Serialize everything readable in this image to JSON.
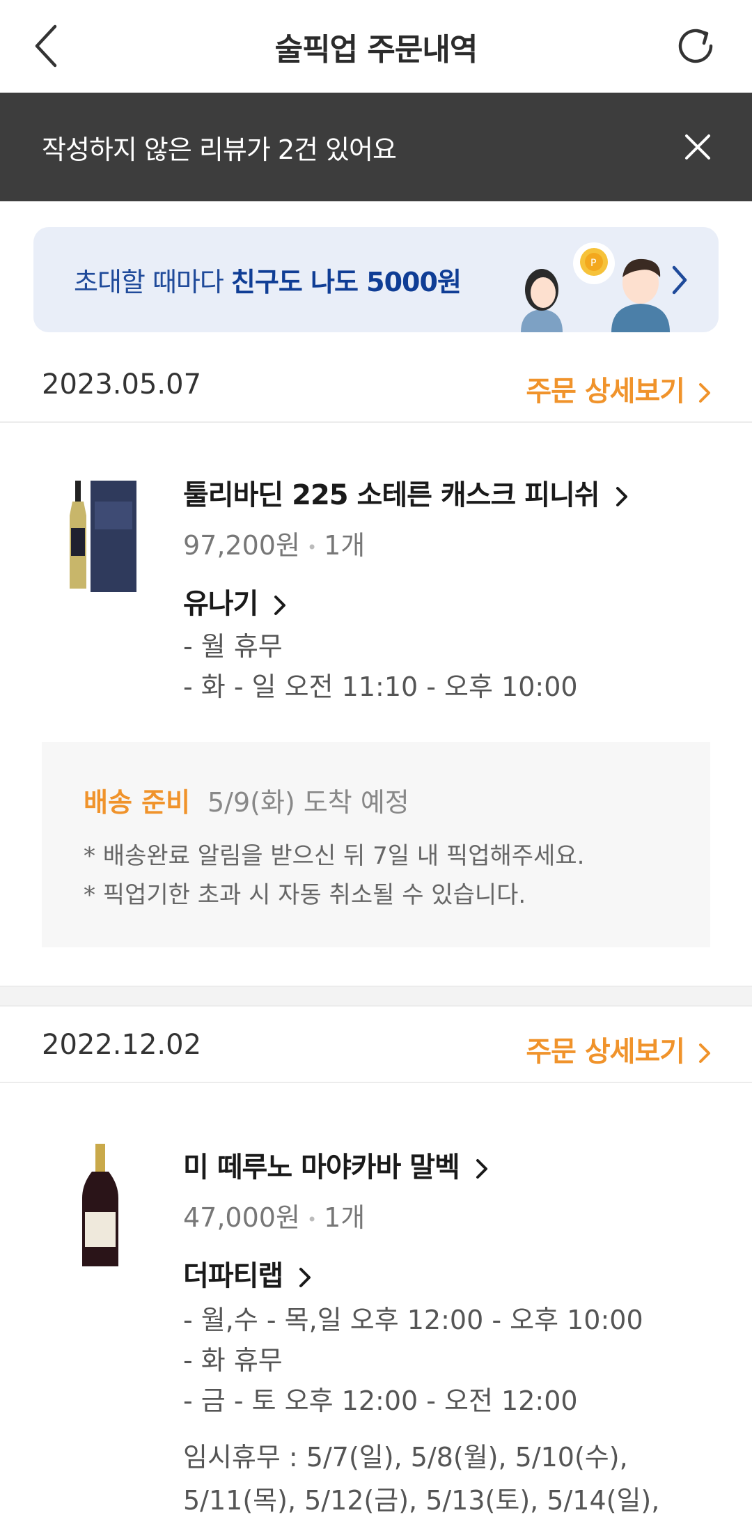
{
  "header": {
    "title": "술픽업 주문내역"
  },
  "review_bar": {
    "text": "작성하지 않은 리뷰가 2건 있어요"
  },
  "banner": {
    "text_normal": "초대할 때마다 ",
    "text_bold": "친구도 나도 5000원"
  },
  "orders": [
    {
      "date": "2023.05.07",
      "detail_label": "주문 상세보기",
      "product": "툴리바딘 225 소테른 캐스크 피니쉬",
      "price": "97,200원",
      "qty": "1개",
      "shop": "유나기",
      "hours": [
        "- 월 휴무",
        "- 화 - 일 오전 11:10 - 오후 10:00"
      ],
      "delivery": {
        "status": "배송 준비",
        "eta": "5/9(화) 도착 예정",
        "notes": [
          "* 배송완료 알림을 받으신 뒤 7일 내 픽업해주세요.",
          "* 픽업기한 초과 시 자동 취소될 수 있습니다."
        ]
      }
    },
    {
      "date": "2022.12.02",
      "detail_label": "주문 상세보기",
      "product": "미 떼루노 마야카바 말벡",
      "price": "47,000원",
      "qty": "1개",
      "shop": "더파티랩",
      "hours": [
        "- 월,수 - 목,일 오후 12:00 - 오후 10:00",
        "- 화 휴무",
        "- 금 - 토 오후 12:00 - 오전 12:00"
      ],
      "closed_days": [
        "임시휴무 : 5/7(일), 5/8(월), 5/10(수),",
        "5/11(목), 5/12(금), 5/13(토), 5/14(일),"
      ]
    }
  ],
  "colors": {
    "accent": "#f0932b",
    "banner_bg": "#e9eef8",
    "review_bar_bg": "#3d3d3d"
  }
}
